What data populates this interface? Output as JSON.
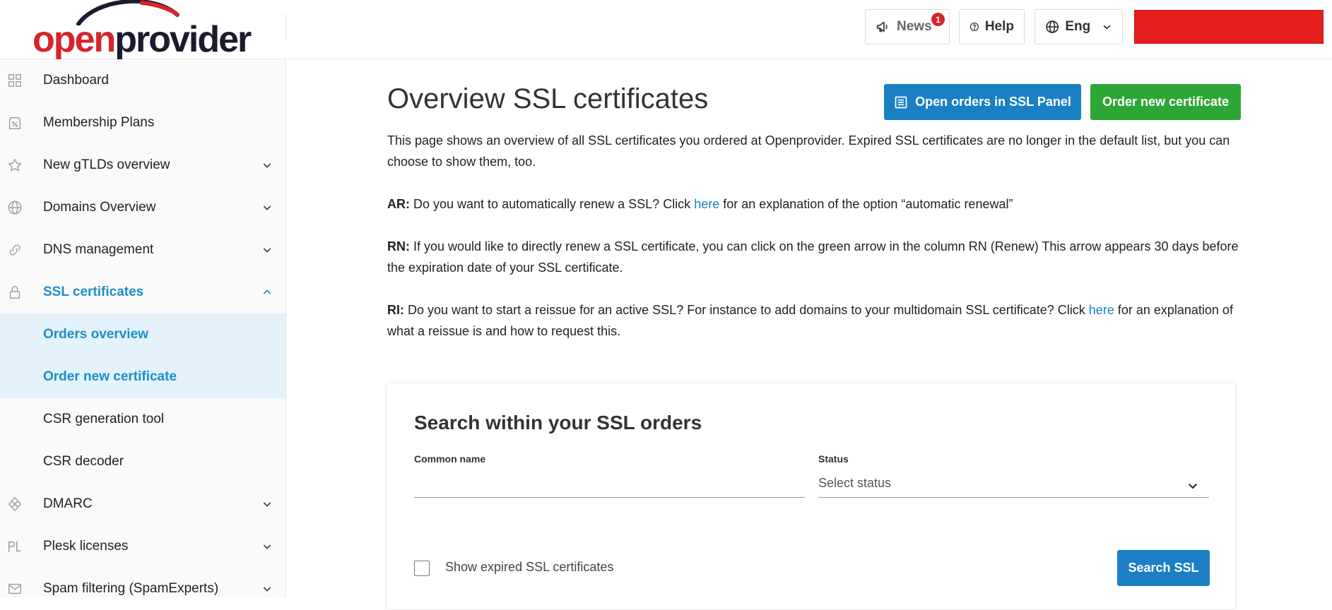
{
  "brand": {
    "logo_part1": "open",
    "logo_part2": "provider",
    "accent": "#d8232a"
  },
  "header": {
    "news_label": "News",
    "news_badge": "1",
    "help_label": "Help",
    "lang_label": "Eng",
    "account_block_color": "#e51e1e"
  },
  "sidebar": {
    "items": [
      {
        "label": "Dashboard",
        "icon": "grid-icon"
      },
      {
        "label": "Membership Plans",
        "icon": "percent-tag-icon"
      },
      {
        "label": "New gTLDs overview",
        "icon": "star-icon",
        "expandable": true
      },
      {
        "label": "Domains Overview",
        "icon": "globe-icon",
        "expandable": true
      },
      {
        "label": "DNS management",
        "icon": "link-icon",
        "expandable": true
      },
      {
        "label": "SSL certificates",
        "icon": "lock-icon",
        "expanded": true,
        "active": true
      },
      {
        "label": "Orders overview",
        "sub": true,
        "highlighted": true
      },
      {
        "label": "Order new certificate",
        "sub": true,
        "highlighted": true
      },
      {
        "label": "CSR generation tool",
        "sub": true
      },
      {
        "label": "CSR decoder",
        "sub": true
      },
      {
        "label": "DMARC",
        "icon": "diamond-icon",
        "expandable": true
      },
      {
        "label": "Plesk licenses",
        "icon": "plesk-icon",
        "expandable": true
      },
      {
        "label": "Spam filtering (SpamExperts)",
        "icon": "mail-icon",
        "expandable": true
      }
    ]
  },
  "main": {
    "title": "Overview SSL certificates",
    "btn_ssl_panel": "Open orders in SSL Panel",
    "btn_order_new": "Order new certificate",
    "intro": "This page shows an overview of all SSL certificates you ordered at Openprovider. Expired SSL certificates are no longer in the default list, but you can choose to show them, too.",
    "ar_prefix": "AR:",
    "ar_text1": " Do you want to automatically renew a SSL? Click ",
    "ar_link": "here",
    "ar_text2": " for an explanation of the option “automatic renewal”",
    "rn_prefix": "RN:",
    "rn_text": " If you would like to directly renew a SSL certificate, you can click on the green arrow in the column RN (Renew) This arrow appears 30 days before the expiration date of your SSL certificate.",
    "ri_prefix": "RI:",
    "ri_text1": " Do you want to start a reissue for an active SSL? For instance to add domains to your multidomain SSL certificate? Click ",
    "ri_link": "here",
    "ri_text2": " for an explanation of what a reissue is and how to request this."
  },
  "search": {
    "title": "Search within your SSL orders",
    "common_name_label": "Common name",
    "common_name_value": "",
    "status_label": "Status",
    "status_placeholder": "Select status",
    "show_expired_label": "Show expired SSL certificates",
    "show_expired_checked": false,
    "search_button": "Search SSL"
  },
  "colors": {
    "primary": "#1b7fc4",
    "success": "#2ea635",
    "active_nav": "#1d8ec8",
    "highlight_bg": "#e4f2fb"
  }
}
